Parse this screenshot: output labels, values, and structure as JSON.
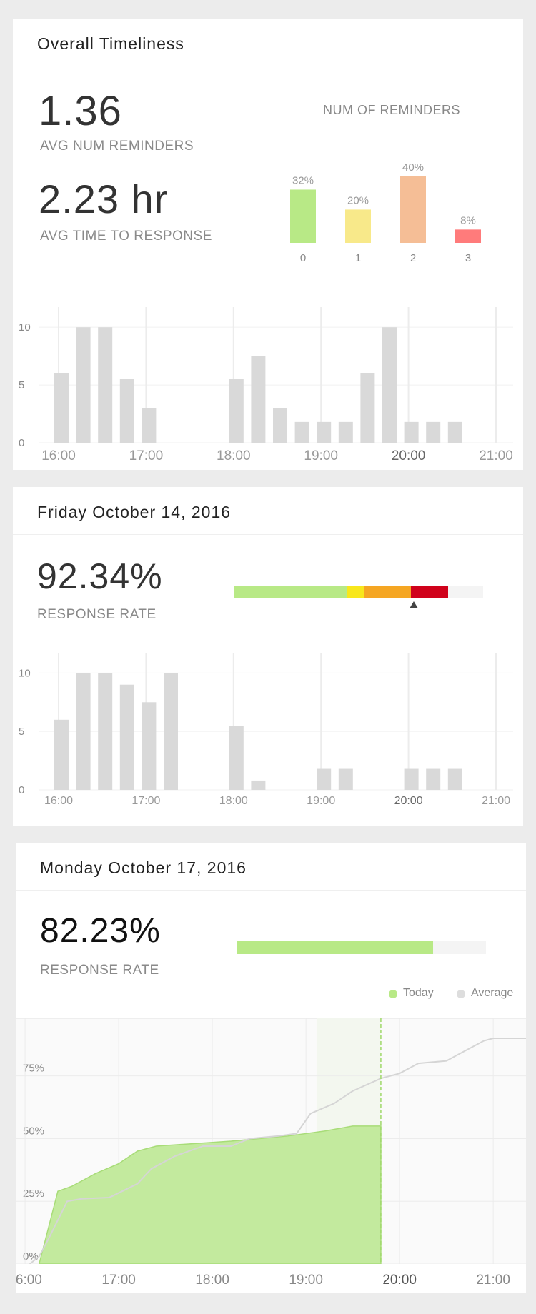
{
  "overall": {
    "title": "Overall Timeliness",
    "avg_reminders_value": "1.36",
    "avg_reminders_label": "AVG NUM REMINDERS",
    "avg_response_value": "2.23 hr",
    "avg_response_label": "AVG TIME TO RESPONSE"
  },
  "friday": {
    "title": "Friday October 14, 2016",
    "rate_value": "92.34%",
    "rate_label": "RESPONSE RATE",
    "stacked_bar": [
      {
        "fraction": 0.45,
        "color": "#b8e986"
      },
      {
        "fraction": 0.07,
        "color": "#f8e71c"
      },
      {
        "fraction": 0.19,
        "color": "#f5a623"
      },
      {
        "fraction": 0.15,
        "color": "#d0021b"
      },
      {
        "fraction": 0.14,
        "color": "#f4f4f4"
      }
    ],
    "marker_fraction": 0.72
  },
  "monday": {
    "title": "Monday October 17, 2016",
    "rate_value": "82.23%",
    "rate_label": "RESPONSE RATE",
    "progress_fraction": 0.7876,
    "legend_today": "Today",
    "legend_average": "Average",
    "today_color": "#b8e986",
    "average_color": "#dddddd"
  },
  "chart_data": [
    {
      "type": "bar",
      "title": "NUM OF REMINDERS",
      "categories": [
        "0",
        "1",
        "2",
        "3"
      ],
      "values": [
        32,
        20,
        40,
        8
      ],
      "value_labels": [
        "32%",
        "20%",
        "40%",
        "8%"
      ],
      "colors": [
        "#b8e986",
        "#f8e98a",
        "#f5be96",
        "#ff7b7b"
      ]
    },
    {
      "type": "bar",
      "x_ticks": [
        "16:00",
        "17:00",
        "18:00",
        "19:00",
        "20:00",
        "21:00"
      ],
      "y_ticks": [
        "0",
        "5",
        "10"
      ],
      "ylim": [
        0,
        11
      ],
      "xlim_hours": [
        16,
        21
      ],
      "x": [
        16.0,
        16.25,
        16.5,
        16.75,
        17.0,
        18.0,
        18.25,
        18.5,
        18.75,
        19.0,
        19.25,
        19.5,
        19.75,
        20.0,
        20.25,
        20.5
      ],
      "values": [
        6,
        10,
        10,
        5.5,
        3,
        5.5,
        7.5,
        3,
        1.8,
        1.8,
        1.8,
        6,
        10,
        1.8,
        1.8,
        1.8
      ],
      "color": "#d9d9d9"
    },
    {
      "type": "bar",
      "x_ticks": [
        "16:00",
        "17:00",
        "18:00",
        "19:00",
        "20:00",
        "21:00"
      ],
      "y_ticks": [
        "0",
        "5",
        "10"
      ],
      "ylim": [
        0,
        11
      ],
      "xlim_hours": [
        16,
        21
      ],
      "x": [
        16.0,
        16.25,
        16.5,
        16.75,
        17.0,
        17.25,
        18.0,
        18.25,
        19.0,
        19.25,
        20.0,
        20.25,
        20.5
      ],
      "values": [
        6,
        10,
        10,
        9,
        7.5,
        10,
        5.5,
        0.8,
        1.8,
        1.8,
        1.8,
        1.8,
        1.8
      ],
      "color": "#d9d9d9"
    },
    {
      "type": "area",
      "x_ticks": [
        "16:00",
        "17:00",
        "18:00",
        "19:00",
        "20:00",
        "21:00"
      ],
      "y_ticks": [
        "0%",
        "25%",
        "50%",
        "75%"
      ],
      "ylim": [
        0,
        100
      ],
      "xlim_hours": [
        15.9,
        21.35
      ],
      "now_hour": 19.8,
      "series": [
        {
          "name": "Today",
          "x": [
            16.15,
            16.35,
            16.5,
            16.75,
            17.0,
            17.2,
            17.4,
            17.8,
            18.2,
            18.5,
            18.8,
            19.2,
            19.5,
            19.8
          ],
          "values": [
            0,
            29,
            31,
            36,
            40,
            45,
            47,
            48,
            49,
            50,
            51,
            53,
            55,
            55
          ]
        },
        {
          "name": "Average",
          "x": [
            16.05,
            16.15,
            16.25,
            16.45,
            16.6,
            16.9,
            17.2,
            17.35,
            17.6,
            17.9,
            18.2,
            18.4,
            18.7,
            18.9,
            19.05,
            19.3,
            19.5,
            19.8,
            20.0,
            20.2,
            20.5,
            20.7,
            20.9,
            21.0,
            21.35
          ],
          "values": [
            0,
            3,
            10,
            25,
            26,
            26.5,
            32,
            38,
            43,
            47,
            47,
            50,
            51,
            52,
            60,
            64,
            69,
            74,
            76,
            80,
            81,
            85,
            89,
            90,
            90
          ]
        }
      ]
    }
  ]
}
